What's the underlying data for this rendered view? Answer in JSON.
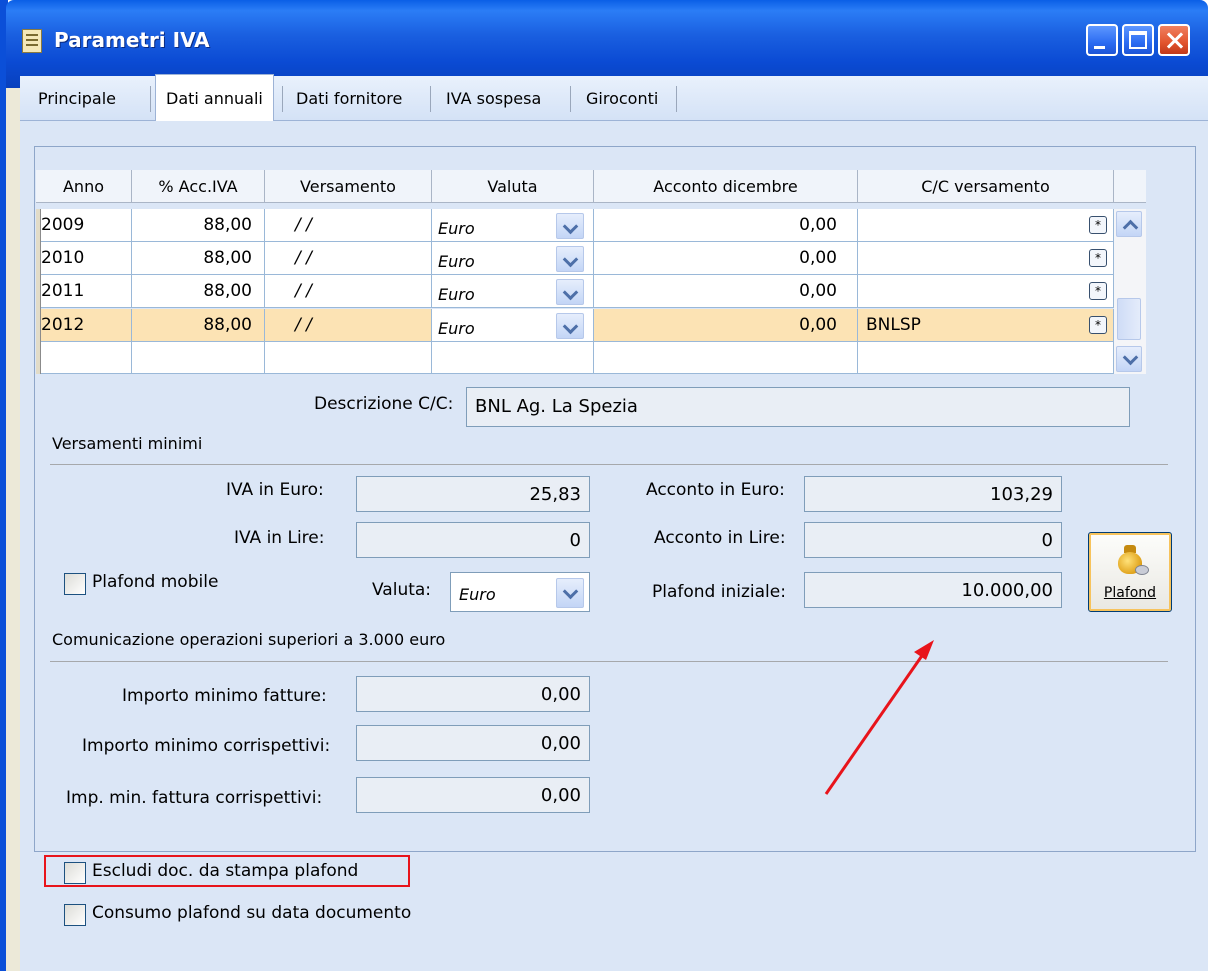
{
  "window": {
    "title": "Parametri IVA"
  },
  "tabs": [
    {
      "label": "Principale",
      "active": false
    },
    {
      "label": "Dati annuali",
      "active": true
    },
    {
      "label": "Dati fornitore",
      "active": false
    },
    {
      "label": "IVA sospesa",
      "active": false
    },
    {
      "label": "Giroconti",
      "active": false
    }
  ],
  "grid": {
    "columns": [
      "Anno",
      "% Acc.IVA",
      "Versamento",
      "Valuta",
      "Acconto dicembre",
      "C/C versamento"
    ],
    "rows": [
      {
        "anno": "2009",
        "acc_iva": "88,00",
        "versamento": "/ /",
        "valuta": "Euro",
        "acconto": "0,00",
        "cc": ""
      },
      {
        "anno": "2010",
        "acc_iva": "88,00",
        "versamento": "/ /",
        "valuta": "Euro",
        "acconto": "0,00",
        "cc": ""
      },
      {
        "anno": "2011",
        "acc_iva": "88,00",
        "versamento": "/ /",
        "valuta": "Euro",
        "acconto": "0,00",
        "cc": ""
      },
      {
        "anno": "2012",
        "acc_iva": "88,00",
        "versamento": "/ /",
        "valuta": "Euro",
        "acconto": "0,00",
        "cc": "BNLSP",
        "selected": true
      }
    ]
  },
  "descrizione_cc": {
    "label": "Descrizione C/C:",
    "value": "BNL Ag. La Spezia"
  },
  "versamenti_minimi": {
    "section_label": "Versamenti minimi",
    "iva_euro_label": "IVA in Euro:",
    "iva_euro_value": "25,83",
    "iva_lire_label": "IVA in Lire:",
    "iva_lire_value": "0",
    "acconto_euro_label": "Acconto in Euro:",
    "acconto_euro_value": "103,29",
    "acconto_lire_label": "Acconto in Lire:",
    "acconto_lire_value": "0",
    "plafond_mobile_label": "Plafond mobile",
    "valuta_label": "Valuta:",
    "valuta_value": "Euro",
    "plafond_iniziale_label": "Plafond iniziale:",
    "plafond_iniziale_value": "10.000,00",
    "plafond_button_label": "Plafond"
  },
  "comunicazione": {
    "section_label": "Comunicazione operazioni superiori a 3.000 euro",
    "importo_fatture_label": "Importo minimo fatture:",
    "importo_fatture_value": "0,00",
    "importo_corrispettivi_label": "Importo minimo corrispettivi:",
    "importo_corrispettivi_value": "0,00",
    "imp_fattura_corr_label": "Imp. min. fattura corrispettivi:",
    "imp_fattura_corr_value": "0,00"
  },
  "options": {
    "escludi_label": "Escludi doc. da stampa plafond",
    "consumo_label": "Consumo plafond su data documento"
  },
  "colors": {
    "annotation_red": "#e8141b",
    "selected_row": "#fce3b4",
    "titlebar": "#0b4bd4"
  }
}
